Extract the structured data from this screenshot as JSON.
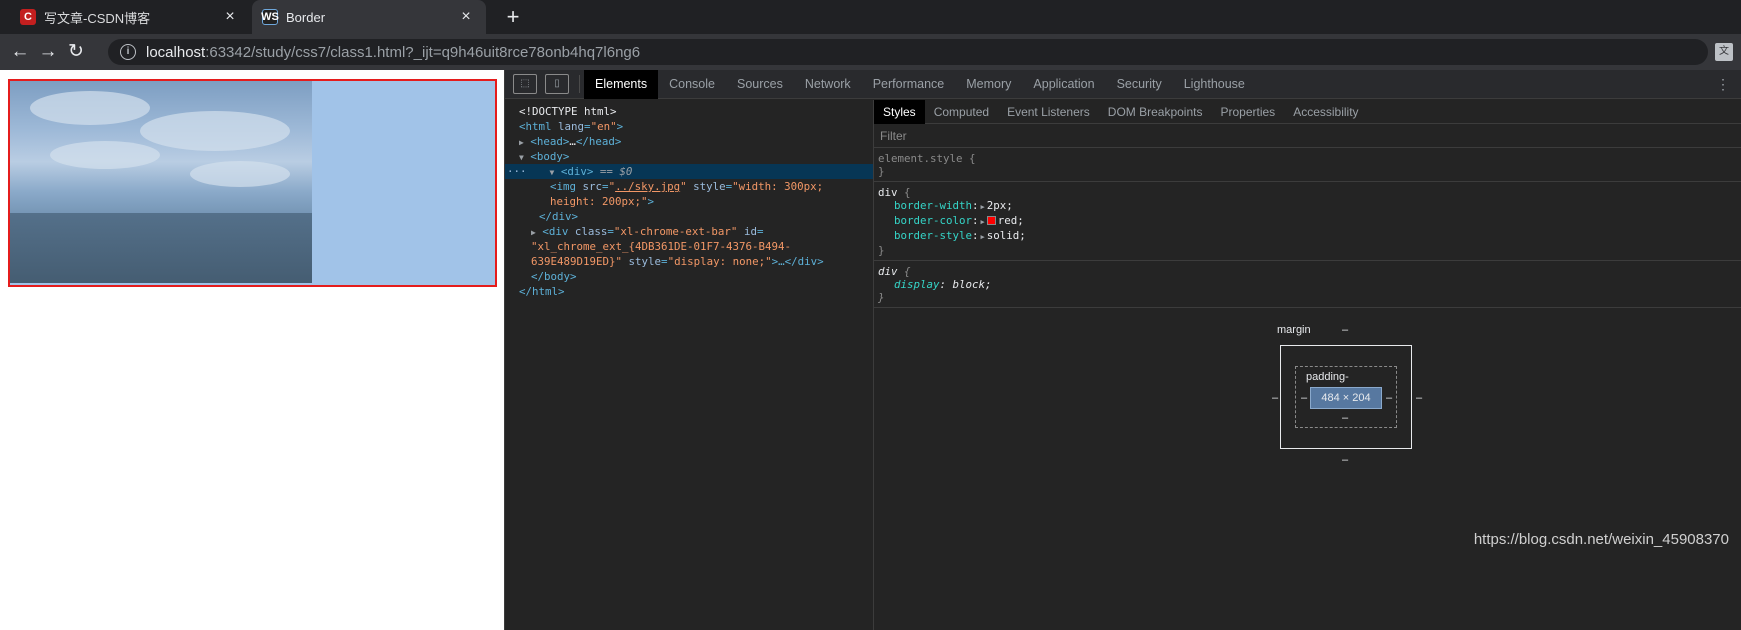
{
  "browser": {
    "tabs": [
      {
        "icon": "C",
        "title": "写文章-CSDN博客",
        "close": "×"
      },
      {
        "icon": "WS",
        "title": "Border",
        "close": "×"
      }
    ],
    "new_tab": "+",
    "nav": {
      "back": "←",
      "forward": "→",
      "reload": "↻"
    },
    "address": {
      "info": "i",
      "host": "localhost",
      "rest": ":63342/study/css7/class1.html?_ijt=q9h46uit8rce78onb4hq7l6ng6"
    },
    "translate": "文"
  },
  "devtools": {
    "tools": [
      "⬚",
      "▯"
    ],
    "tabs": [
      "Elements",
      "Console",
      "Sources",
      "Network",
      "Performance",
      "Memory",
      "Application",
      "Security",
      "Lighthouse"
    ],
    "more": "⋮",
    "dom": {
      "doctype": "<!DOCTYPE html>",
      "html_open_tag": "<html",
      "html_lang_attr": "lang",
      "html_lang_val": "\"en\"",
      "html_open_close": ">",
      "head_open": "<head>",
      "head_dots": "…",
      "head_close": "</head>",
      "body_open": "<body>",
      "sel_ellipsis": "···",
      "div_open": "<div>",
      "div_eq": " == $0",
      "img_tag": "<img",
      "img_src_attr": "src",
      "img_src_val": "../sky.jpg",
      "img_style_attr": "style",
      "img_style_val1": "\"width: 300px;",
      "img_style_val2": "height: 200px;\"",
      "img_end": ">",
      "div_close": "</div>",
      "div2_open": "<div",
      "div2_class_attr": "class",
      "div2_class_val": "\"xl-chrome-ext-bar\"",
      "div2_id_attr": "id",
      "div2_id_val1": "\"xl_chrome_ext_{4DB361DE-01F7-4376-B494-",
      "div2_id_val2": "639E489D19ED}\"",
      "div2_style_attr": "style",
      "div2_style_val": "\"display: none;\"",
      "div2_end": ">…</div>",
      "body_close": "</body>",
      "html_close": "</html>"
    },
    "styles_tabs": [
      "Styles",
      "Computed",
      "Event Listeners",
      "DOM Breakpoints",
      "Properties",
      "Accessibility"
    ],
    "filter_placeholder": "Filter",
    "rules": {
      "element_style": "element.style {",
      "brace_close": "}",
      "div_sel": "div",
      "brace_open": " {",
      "props": [
        {
          "name": "border-width",
          "value": "2px;"
        },
        {
          "name": "border-color",
          "value": "red;"
        },
        {
          "name": "border-style",
          "value": "solid;"
        }
      ],
      "ua_sel": "div",
      "ua_prop": "display",
      "ua_val": "block;"
    },
    "box_model": {
      "margin_label": "margin",
      "padding_label": "padding-",
      "content_size": "484 × 204",
      "dash": "–"
    }
  },
  "watermark": "https://blog.csdn.net/weixin_45908370"
}
